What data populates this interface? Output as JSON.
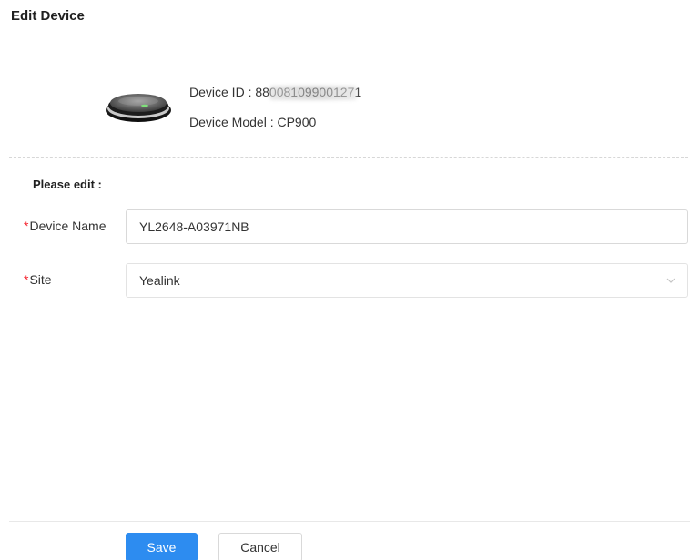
{
  "header": {
    "title": "Edit Device"
  },
  "device": {
    "id_label": "Device ID :",
    "id_value": "880081099001271",
    "model_label": "Device Model :",
    "model_value": "CP900",
    "image_icon": "conference-speakerphone-icon"
  },
  "form": {
    "heading": "Please edit :",
    "required_mark": "*",
    "device_name": {
      "label": "Device Name",
      "value": "YL2648-A03971NB"
    },
    "site": {
      "label": "Site",
      "selected": "Yealink",
      "icon": "chevron-down-icon"
    }
  },
  "footer": {
    "save_label": "Save",
    "cancel_label": "Cancel"
  },
  "colors": {
    "primary": "#2d8cf0",
    "required": "#f5222d",
    "border": "#d9d9d9"
  }
}
